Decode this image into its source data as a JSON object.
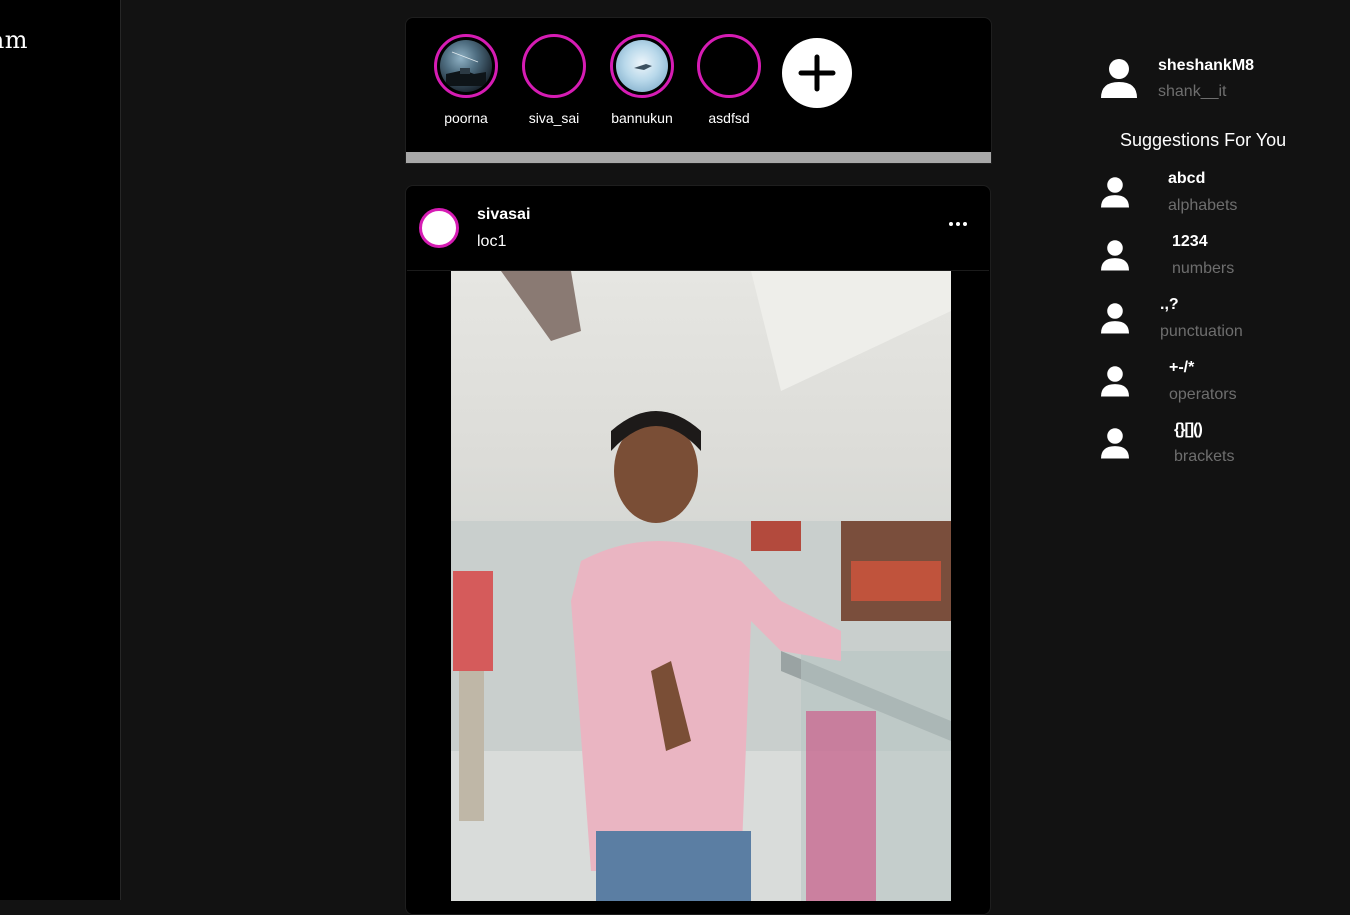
{
  "sidebar": {
    "logo_text": "ram"
  },
  "stories": [
    {
      "name": "poorna",
      "image": "night-sky"
    },
    {
      "name": "siva_sai",
      "image": "empty"
    },
    {
      "name": "bannukun",
      "image": "sky"
    },
    {
      "name": "asdfsd",
      "image": "empty"
    }
  ],
  "add_story_icon": "plus-icon",
  "post": {
    "username": "sivasai",
    "location": "loc1",
    "more_icon": "more-horizontal-icon"
  },
  "current_user": {
    "username": "sheshankM8",
    "handle": "shank__it"
  },
  "suggestions_title": "Suggestions For You",
  "suggestions": [
    {
      "name": "abcd",
      "subtitle": "alphabets"
    },
    {
      "name": "1234",
      "subtitle": "numbers"
    },
    {
      "name": ".,?",
      "subtitle": "punctuation"
    },
    {
      "name": "+-/*",
      "subtitle": "operators"
    },
    {
      "name": "{}[]()",
      "subtitle": "brackets"
    }
  ],
  "colors": {
    "story_ring": "#d61cb4",
    "background": "#121212",
    "panel": "#000000",
    "muted_text": "#6e6e6e"
  }
}
